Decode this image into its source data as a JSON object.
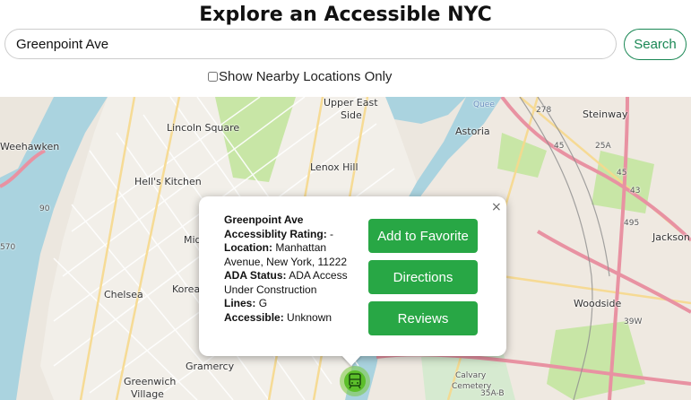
{
  "page": {
    "title": "Explore an Accessible NYC"
  },
  "search": {
    "value": "Greenpoint Ave",
    "button_label": "Search"
  },
  "filter": {
    "nearby_label": "Show Nearby Locations Only",
    "nearby_checked": false
  },
  "map_labels": {
    "weehawken": "Weehawken",
    "lincoln_square": "Lincoln Square",
    "upper_east_side_1": "Upper East",
    "upper_east_side_2": "Side",
    "hells_kitchen": "Hell's Kitchen",
    "lenox_hill": "Lenox Hill",
    "astoria": "Astoria",
    "steinway": "Steinway",
    "chelsea": "Chelsea",
    "korea": "Korea",
    "mid": "Mid",
    "jackson": "Jackson",
    "woodside": "Woodside",
    "gramercy": "Gramercy",
    "greenwich_1": "Greenwich",
    "greenwich_2": "Village",
    "calvary_1": "Calvary",
    "calvary_2": "Cemetery",
    "queens": "Quee",
    "route_495": "495",
    "route_278": "278",
    "route_25": "25A",
    "num_45a": "45",
    "num_45b": "45",
    "num_43": "43",
    "num_39w": "39W",
    "num_35ab": "35A-B",
    "num_570": "570",
    "num_90": "90"
  },
  "popup": {
    "close_label": "×",
    "station_name": "Greenpoint Ave",
    "rating_label": "Accessiblity Rating:",
    "rating_value": "-",
    "location_label": "Location:",
    "location_value": "Manhattan Avenue, New York, 11222",
    "ada_label": "ADA Status:",
    "ada_value": "ADA Access Under Construction",
    "lines_label": "Lines:",
    "lines_value": "G",
    "accessible_label": "Accessible:",
    "accessible_value": "Unknown",
    "buttons": {
      "favorite": "Add to Favorite",
      "directions": "Directions",
      "reviews": "Reviews"
    }
  },
  "colors": {
    "accent": "#198754",
    "button": "#28a745",
    "water": "#aad3df",
    "park": "#c8e6a6",
    "highway": "#e892a2"
  },
  "icons": {
    "station_marker": "train-icon"
  }
}
